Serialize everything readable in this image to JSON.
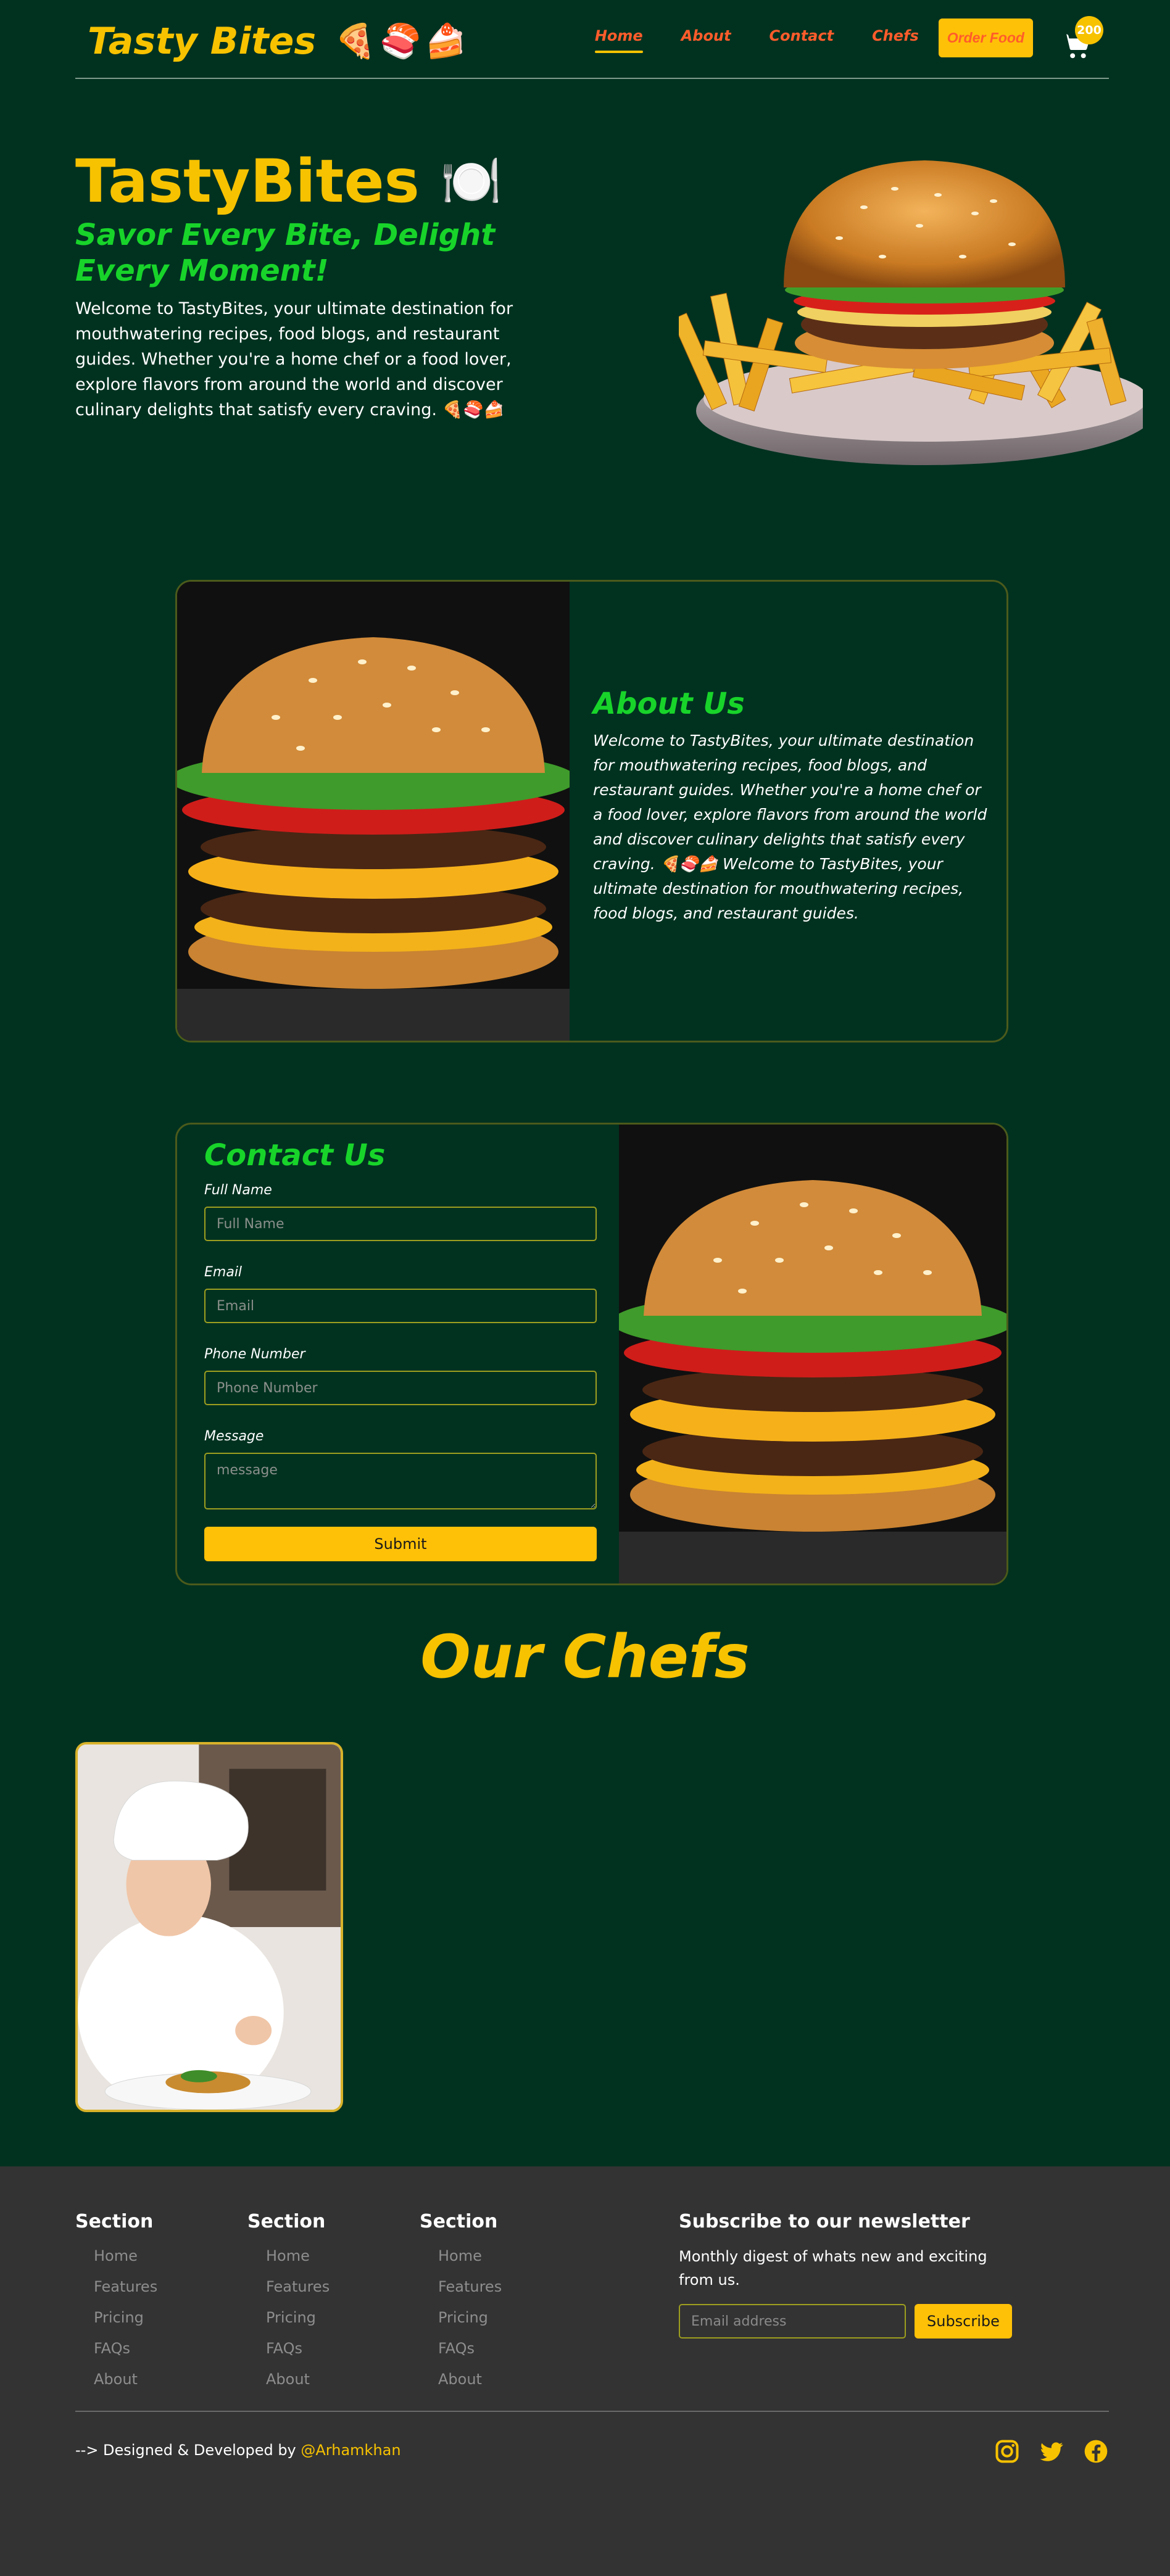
{
  "brand": {
    "name": "Tasty Bites",
    "emoji": "🍕🍣🍰"
  },
  "nav": {
    "links": [
      "Home",
      "About",
      "Contact",
      "Chefs"
    ],
    "order_label": "Order Food",
    "cart_count": "200"
  },
  "hero": {
    "title": "TastyBites",
    "title_emoji": "🍽️",
    "tagline": "Savor Every Bite, Delight Every Moment!",
    "text": "Welcome to TastyBites, your ultimate destination for mouthwatering recipes, food blogs, and restaurant guides. Whether you're a home chef or a food lover, explore flavors from around the world and discover culinary delights that satisfy every craving. 🍕🍣🍰"
  },
  "about": {
    "title": "About Us",
    "text": "Welcome to TastyBites, your ultimate destination for mouthwatering recipes, food blogs, and restaurant guides. Whether you're a home chef or a food lover, explore flavors from around the world and discover culinary delights that satisfy every craving. 🍕🍣🍰 Welcome to TastyBites, your ultimate destination for mouthwatering recipes, food blogs, and restaurant guides."
  },
  "contact": {
    "title": "Contact Us",
    "fields": {
      "name_label": "Full Name",
      "name_placeholder": "Full Name",
      "email_label": "Email",
      "email_placeholder": "Email",
      "phone_label": "Phone Number",
      "phone_placeholder": "Phone Number",
      "message_label": "Message",
      "message_placeholder": "message"
    },
    "submit_label": "Submit"
  },
  "chefs": {
    "title": "Our Chefs"
  },
  "footer": {
    "columns": [
      {
        "title": "Section",
        "links": [
          "Home",
          "Features",
          "Pricing",
          "FAQs",
          "About"
        ]
      },
      {
        "title": "Section",
        "links": [
          "Home",
          "Features",
          "Pricing",
          "FAQs",
          "About"
        ]
      },
      {
        "title": "Section",
        "links": [
          "Home",
          "Features",
          "Pricing",
          "FAQs",
          "About"
        ]
      }
    ],
    "newsletter": {
      "title": "Subscribe to our newsletter",
      "text": "Monthly digest of whats new and exciting from us.",
      "placeholder": "Email address",
      "button": "Subscribe"
    },
    "credit_prefix": "--> Designed & Developed by ",
    "credit_handle": "@Arhamkhan",
    "socials": [
      "instagram-icon",
      "twitter-icon",
      "facebook-icon"
    ]
  },
  "colors": {
    "background": "#013220",
    "accent": "#f7c200",
    "green": "#18d42a",
    "nav_link": "#ff5c2b",
    "footer_bg": "#333333"
  }
}
